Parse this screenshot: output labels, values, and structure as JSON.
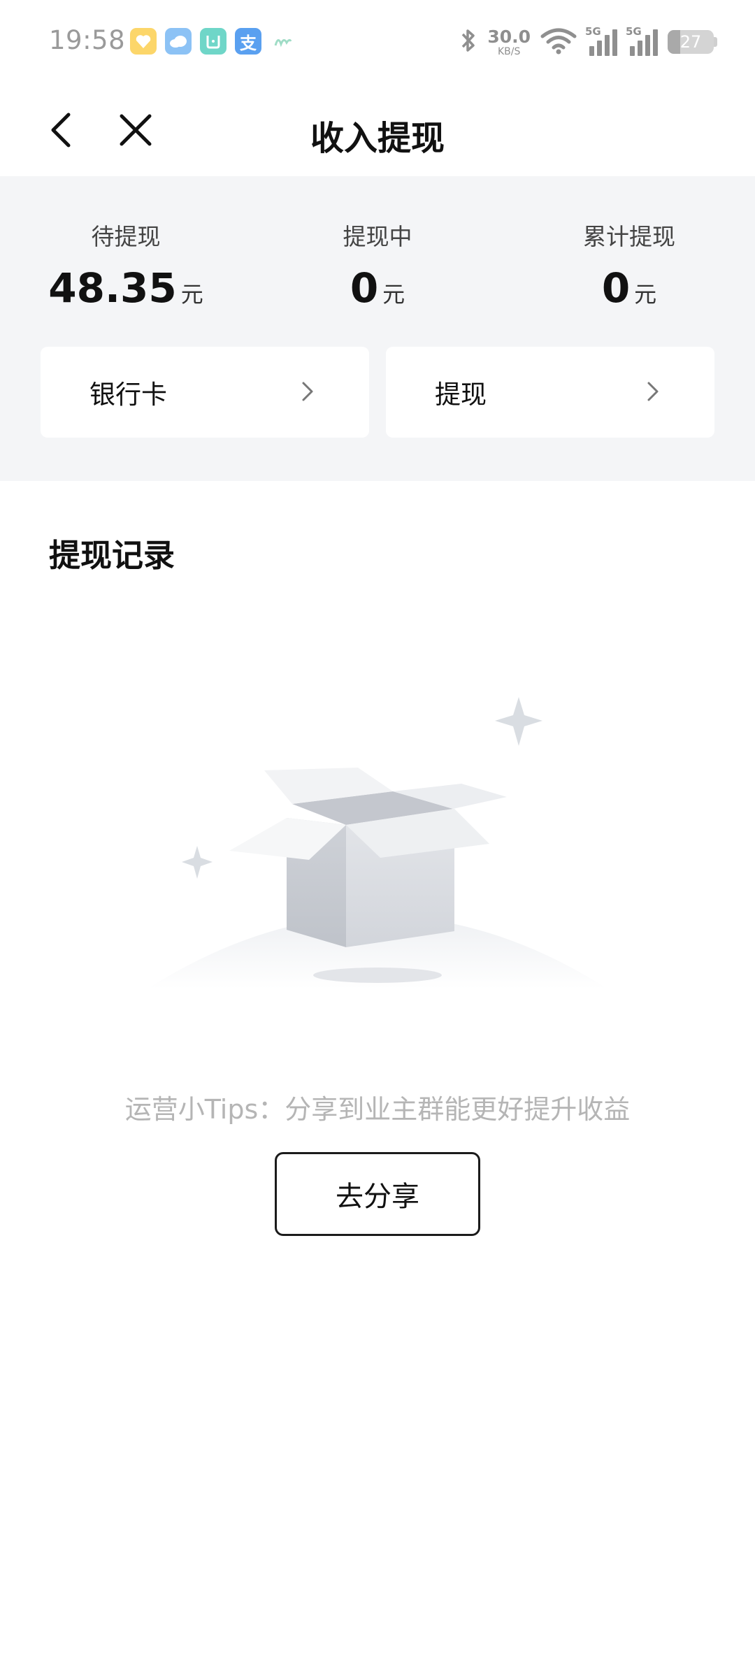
{
  "status_bar": {
    "time": "19:58",
    "app_icons": [
      "heart-app-icon",
      "weather-app-icon",
      "mi-home-app-icon",
      "alipay-app-icon",
      "misc-app-icon"
    ],
    "alipay_glyph": "支",
    "network_speed": "30.0",
    "network_speed_unit": "KB/S",
    "signal_1_label": "5G",
    "signal_2_label": "5G",
    "battery_percent": "27",
    "battery_level": 0.27
  },
  "nav": {
    "back_icon": "chevron-left-icon",
    "close_icon": "close-icon",
    "title": "收入提现"
  },
  "summary": {
    "pending": {
      "label": "待提现",
      "value": "48.35",
      "unit": "元"
    },
    "processing": {
      "label": "提现中",
      "value": "0",
      "unit": "元"
    },
    "total": {
      "label": "累计提现",
      "value": "0",
      "unit": "元"
    }
  },
  "actions": {
    "bank_card": {
      "label": "银行卡",
      "icon": "chevron-right-icon"
    },
    "withdraw": {
      "label": "提现",
      "icon": "chevron-right-icon"
    }
  },
  "records": {
    "title": "提现记录",
    "empty_illustration": "empty-box-illustration",
    "tips": "运营小Tips：分享到业主群能更好提升收益",
    "share_button": "去分享"
  },
  "colors": {
    "summary_bg": "#f4f5f7",
    "text_primary": "#111111",
    "text_muted": "#b5b5b5",
    "status_gray": "#8f8f8f"
  }
}
